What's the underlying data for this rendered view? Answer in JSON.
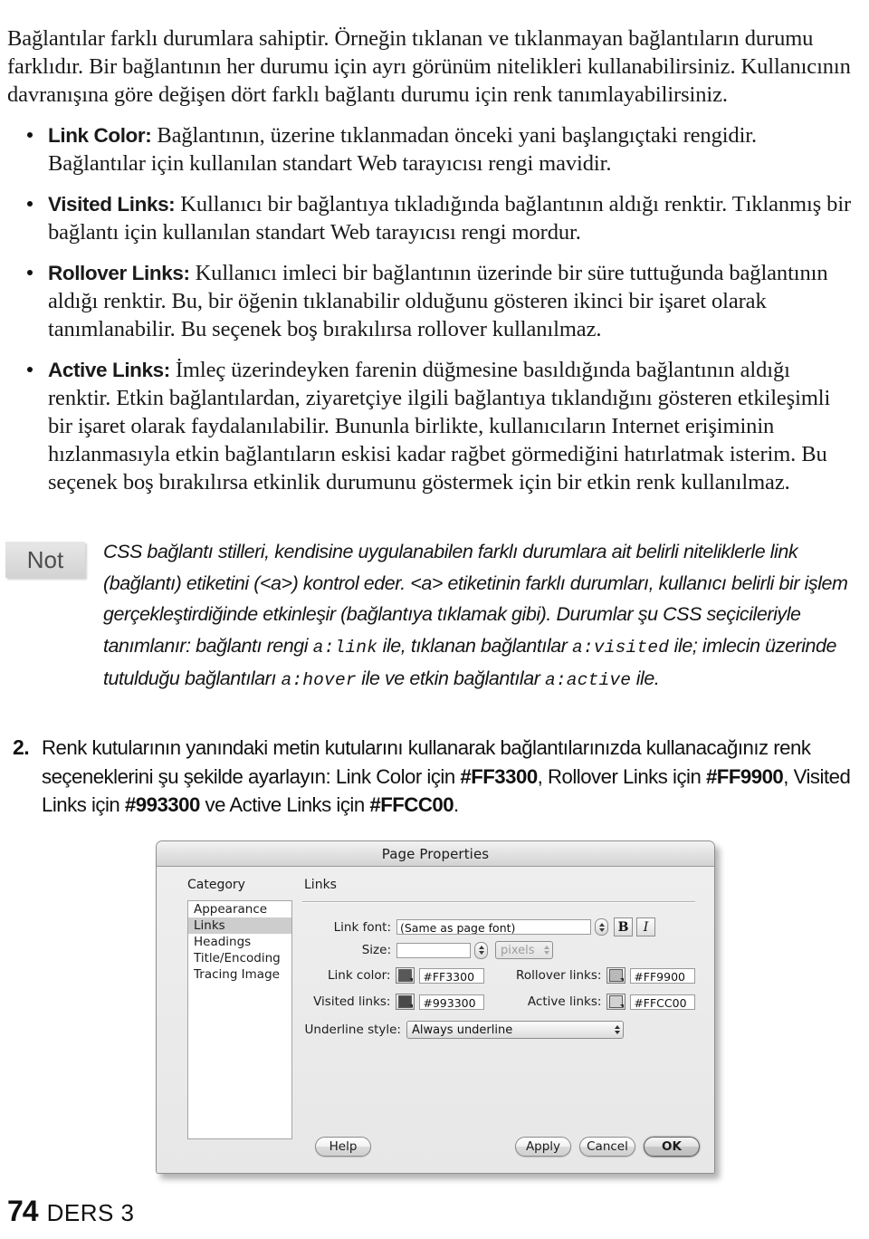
{
  "document": {
    "intro_paragraph": "Bağlantılar farklı durumlara sahiptir. Örneğin tıklanan ve tıklanmayan bağlantıların durumu farklıdır. Bir bağlantının her durumu için ayrı görünüm nitelikleri kullanabilirsiniz. Kullanıcının davranışına göre değişen dört farklı bağlantı durumu için renk tanımlayabilirsiniz.",
    "bullets": [
      {
        "term": "Link Color:",
        "text": " Bağlantının, üzerine tıklanmadan önceki yani başlangıçtaki rengidir. Bağlantılar için kullanılan standart Web tarayıcısı rengi mavidir."
      },
      {
        "term": "Visited Links:",
        "text": " Kullanıcı bir bağlantıya tıkladığında bağlantının aldığı renktir. Tıklanmış bir bağlantı için kullanılan standart Web tarayıcısı rengi mordur."
      },
      {
        "term": "Rollover Links:",
        "text": " Kullanıcı imleci bir bağlantının üzerinde bir süre tuttuğunda bağlantının aldığı renktir. Bu, bir öğenin tıklanabilir olduğunu gösteren ikinci bir işaret olarak tanımlanabilir. Bu seçenek boş bırakılırsa rollover kullanılmaz."
      },
      {
        "term": "Active Links:",
        "text": " İmleç üzerindeyken farenin düğmesine basıldığında bağlantının aldığı renktir. Etkin bağlantılardan, ziyaretçiye ilgili bağlantıya tıklandığını gösteren etkileşimli bir işaret olarak faydalanılabilir. Bununla birlikte, kullanıcıların Internet erişiminin hızlanmasıyla etkin bağlantıların eskisi kadar rağbet görmediğini hatırlatmak isterim. Bu seçenek boş bırakılırsa etkinlik durumunu göstermek için bir etkin renk kullanılmaz."
      }
    ],
    "note": {
      "badge": "Not",
      "part1": "CSS bağlantı stilleri, kendisine uygulanabilen farklı durumlara ait belirli niteliklerle link (bağlantı) etiketini (<a>) kontrol eder. <a> etiketinin farklı durumları, kullanıcı belirli bir işlem gerçekleştirdiğinde etkinleşir (bağlantıya tıklamak gibi). Durumlar şu CSS seçicileriyle tanımlanır: bağlantı rengi ",
      "code1": "a:link",
      "part2": " ile, tıklanan bağlantılar ",
      "code2": "a:visited",
      "part3": " ile; imlecin üzerinde tutulduğu bağlantıları ",
      "code3": "a:hover",
      "part4": " ile ve etkin bağlantılar ",
      "code4": "a:active",
      "part5": " ile."
    },
    "step": {
      "number": "2.",
      "text_part1": "Renk kutularının yanındaki metin kutularını kullanarak bağlantılarınızda kullanacağınız renk seçeneklerini şu şekilde ayarlayın: Link Color için ",
      "color1": "#FF3300",
      "text_part2": ", Rollover Links için ",
      "color2": "#FF9900",
      "text_part3": ", Visited Links için ",
      "color3": "#993300",
      "text_part4": " ve Active Links için ",
      "color4": "#FFCC00",
      "text_part5": "."
    },
    "footer": {
      "page_number": "74",
      "label": "DERS 3"
    }
  },
  "dialog": {
    "title": "Page Properties",
    "category_label": "Category",
    "categories": [
      {
        "label": "Appearance",
        "selected": false
      },
      {
        "label": "Links",
        "selected": true
      },
      {
        "label": "Headings",
        "selected": false
      },
      {
        "label": "Title/Encoding",
        "selected": false
      },
      {
        "label": "Tracing Image",
        "selected": false
      }
    ],
    "pane_title": "Links",
    "fields": {
      "link_font_label": "Link font:",
      "link_font_value": "(Same as page font)",
      "bold_label": "B",
      "italic_label": "I",
      "size_label": "Size:",
      "size_value": "",
      "size_units": "pixels",
      "link_color_label": "Link color:",
      "link_color_value": "#FF3300",
      "rollover_links_label": "Rollover links:",
      "rollover_links_value": "#FF9900",
      "visited_links_label": "Visited links:",
      "visited_links_value": "#993300",
      "active_links_label": "Active links:",
      "active_links_value": "#FFCC00",
      "underline_style_label": "Underline style:",
      "underline_style_value": "Always underline"
    },
    "swatch_colors": {
      "link_color": "#585858",
      "rollover_links": "#b9b9b9",
      "visited_links": "#4a4a4a",
      "active_links": "#d2d2d2"
    },
    "buttons": {
      "help": "Help",
      "apply": "Apply",
      "cancel": "Cancel",
      "ok": "OK"
    }
  }
}
